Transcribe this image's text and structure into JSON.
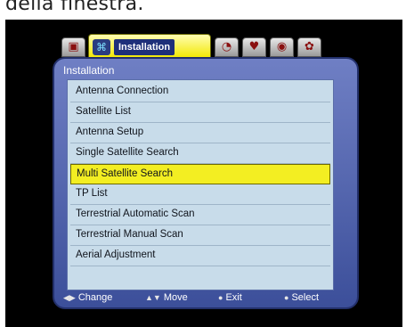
{
  "caption": "della finestra.",
  "tabs": [
    {
      "icon": "tv-icon",
      "glyph": "▣"
    },
    {
      "icon": "satellite-dish-icon",
      "label": "Installation",
      "glyph": "⌘",
      "active": true
    },
    {
      "icon": "clock-icon",
      "glyph": "◔"
    },
    {
      "icon": "heart-icon",
      "glyph": "♥"
    },
    {
      "icon": "globe-icon",
      "glyph": "◉"
    },
    {
      "icon": "gear-icon",
      "glyph": "✿"
    }
  ],
  "panel": {
    "title": "Installation",
    "items": [
      {
        "label": "Antenna Connection"
      },
      {
        "label": "Satellite List"
      },
      {
        "label": "Antenna Setup"
      },
      {
        "label": "Single Satellite Search"
      },
      {
        "label": "Multi Satellite Search",
        "selected": true
      },
      {
        "label": "TP List"
      },
      {
        "label": "Terrestrial Automatic Scan"
      },
      {
        "label": "Terrestrial Manual Scan"
      },
      {
        "label": "Aerial Adjustment"
      }
    ]
  },
  "footer": {
    "change_keys": "◀▶",
    "change": "Change",
    "move_keys": "▲▼",
    "move": "Move",
    "exit_key": "●",
    "exit": "Exit",
    "select_key": "●",
    "select": "Select"
  },
  "colors": {
    "panel": "#4a5aa8",
    "list_bg": "#c8dcea",
    "highlight": "#f3ee22",
    "active_tab": "#f2e800"
  }
}
